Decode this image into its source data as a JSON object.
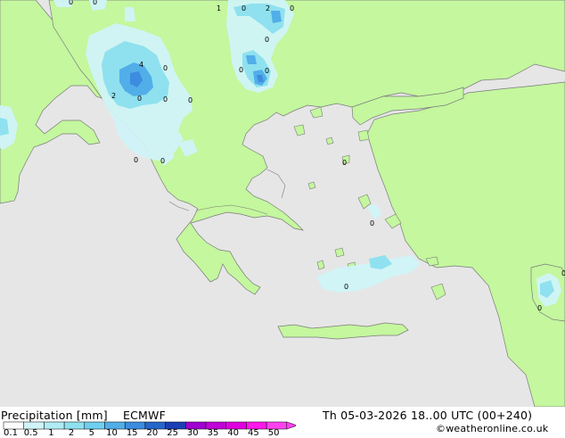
{
  "title": {
    "label": "Precipitation [mm]",
    "model": "ECMWF"
  },
  "valid_time": "Th 05-03-2026 18..00 UTC (00+240)",
  "copyright": "©weatheronline.co.uk",
  "legend": {
    "ticks": [
      "0.1",
      "0.5",
      "1",
      "2",
      "5",
      "10",
      "15",
      "20",
      "25",
      "30",
      "35",
      "40",
      "45",
      "50"
    ],
    "colors": [
      "#fdfdfd",
      "#d0f4f8",
      "#b0ecf4",
      "#8fe1ef",
      "#6fcff0",
      "#52aee8",
      "#3c8ce0",
      "#2566c9",
      "#1b3fb4",
      "#a000d0",
      "#c000d8",
      "#e000e0",
      "#ff18ec",
      "#ff40f0"
    ]
  },
  "colors": {
    "sea": "#e6e6e6",
    "land": "#c4f79e",
    "coast": "#7a7a7a",
    "precip_light": "#d0f4f8",
    "precip_mid": "#8fe1ef",
    "precip_heavy": "#52aee8",
    "precip_core": "#3c8ce0"
  },
  "map_labels": [
    "0",
    "1",
    "0",
    "2",
    "0",
    "0",
    "4",
    "0",
    "0",
    "0",
    "2",
    "0",
    "0",
    "0",
    "0",
    "0",
    "0",
    "0",
    "0",
    "0",
    "0",
    "0"
  ]
}
